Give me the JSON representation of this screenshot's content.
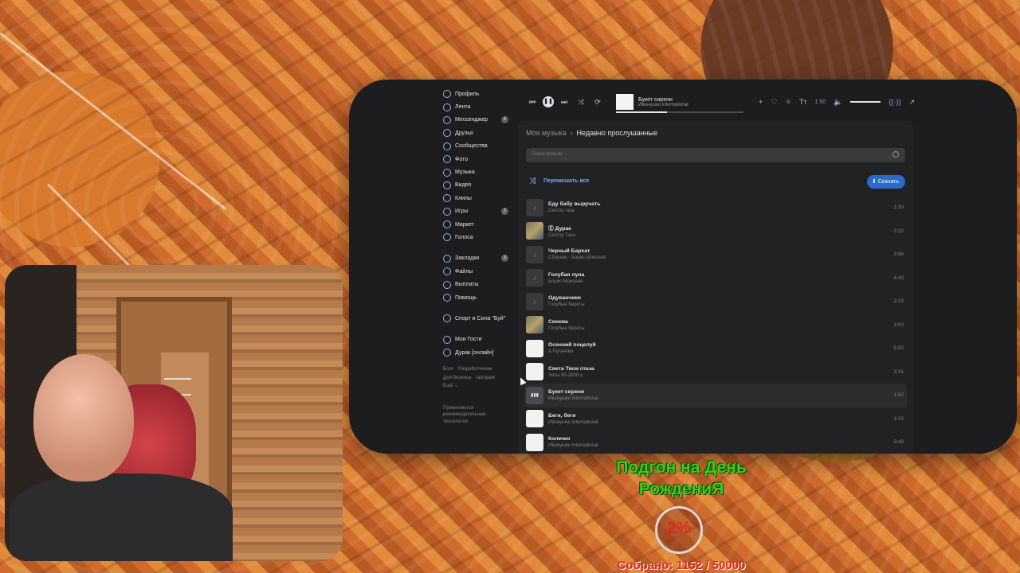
{
  "sidebar": {
    "items": [
      {
        "label": "Профиль",
        "icon": "profile-icon"
      },
      {
        "label": "Лента",
        "icon": "feed-icon"
      },
      {
        "label": "Мессенджер",
        "icon": "messenger-icon",
        "badge": "2"
      },
      {
        "label": "Друзья",
        "icon": "friends-icon"
      },
      {
        "label": "Сообщества",
        "icon": "communities-icon"
      },
      {
        "label": "Фото",
        "icon": "photo-icon"
      },
      {
        "label": "Музыка",
        "icon": "music-icon"
      },
      {
        "label": "Видео",
        "icon": "video-icon"
      },
      {
        "label": "Клипы",
        "icon": "clips-icon"
      },
      {
        "label": "Игры",
        "icon": "games-icon",
        "badge": "2"
      },
      {
        "label": "Маркет",
        "icon": "market-icon"
      },
      {
        "label": "Голоса",
        "icon": "votes-icon"
      }
    ],
    "items2": [
      {
        "label": "Закладки",
        "icon": "bookmarks-icon",
        "badge": "3"
      },
      {
        "label": "Файлы",
        "icon": "files-icon"
      },
      {
        "label": "Выплаты",
        "icon": "payouts-icon"
      },
      {
        "label": "Помощь",
        "icon": "help-icon"
      }
    ],
    "group": "Спорт и Сила \"Буй\"",
    "apps": [
      "Мои Гости",
      "Дурак [онлайн]"
    ],
    "footer": {
      "blog": "Блог",
      "dev": "Разработчикам",
      "business": "Для бизнеса",
      "authors": "Авторам",
      "more": "Ещё ⌄"
    },
    "note": "Применяются рекомендательные технологии"
  },
  "player": {
    "title": "Букет сирени",
    "artist": "Иванушки International",
    "time": "1:50"
  },
  "music": {
    "breadcrumb_root": "Моя музыка",
    "breadcrumb_sep": "›",
    "breadcrumb_current": "Недавно прослушанные",
    "search_placeholder": "Поиск музыки",
    "shuffle_label": "Перемешать все",
    "download_label": "Скачать",
    "tracks": [
      {
        "title": "Еду бабу выручать",
        "artist": "Сектор газа",
        "duration": "1:30",
        "cover": "note"
      },
      {
        "title": "Ⓔ Дурак",
        "artist": "Сектор Газа",
        "duration": "3:22",
        "cover": "photo"
      },
      {
        "title": "Черный Бархат",
        "artist": "Сборник - Борис Моисеев",
        "duration": "3:56",
        "cover": "note"
      },
      {
        "title": "Голубая луна",
        "artist": "Борис Моисеев",
        "duration": "4:43",
        "cover": "note"
      },
      {
        "title": "Одуванчики",
        "artist": "Голубые береты",
        "duration": "2:23",
        "cover": "note"
      },
      {
        "title": "Синева",
        "artist": "Голубые береты",
        "duration": "3:00",
        "cover": "photo"
      },
      {
        "title": "Осенний поцелуй",
        "artist": "А.Пугачёва",
        "duration": "5:00",
        "cover": "white"
      },
      {
        "title": "Света Твои глаза",
        "artist": "Хиты 90-2000-х",
        "duration": "3:31",
        "cover": "white"
      },
      {
        "title": "Букет сирени",
        "artist": "Иванушки International",
        "duration": "1:50",
        "cover": "playing",
        "active": true
      },
      {
        "title": "Беги, беги",
        "artist": "Иванушки International",
        "duration": "4:19",
        "cover": "white"
      },
      {
        "title": "Колечко",
        "artist": "Иванушки International",
        "duration": "3:49",
        "cover": "white"
      }
    ]
  },
  "donation": {
    "title": "Подгон на День РождениЯ",
    "percent": "2%",
    "collected": "Собрано: 1152 / 50000"
  },
  "colors": {
    "accent": "#71aaeb",
    "download": "#2a6ac8",
    "donate_green": "#33d41a",
    "donate_red": "#e0281e"
  }
}
